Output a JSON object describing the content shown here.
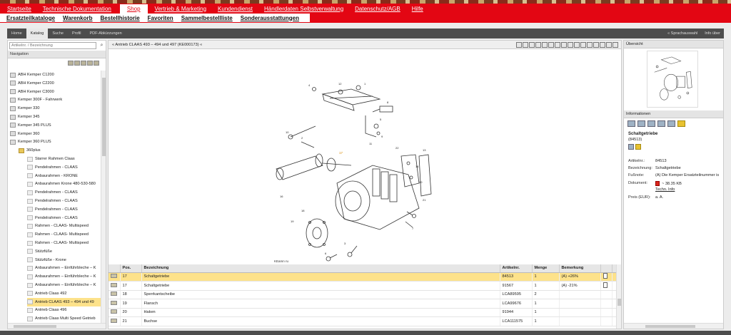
{
  "main_nav": {
    "items": [
      "Startseite",
      "Technische Dokumentation",
      "Shop",
      "Vertrieb & Marketing",
      "Kundendienst",
      "Händlerdaten Selbstverwaltung",
      "Datenschutz/AGB",
      "Hilfe"
    ],
    "active": "Shop"
  },
  "sub_nav": {
    "items": [
      "Ersatzteilkataloge",
      "Warenkorb",
      "Bestellhistorie",
      "Favoriten",
      "Sammelbestellliste",
      "Sonderausstattungen"
    ]
  },
  "toolbar": {
    "tabs": [
      "Home",
      "Katalog",
      "Suche",
      "Profil",
      "PDF-Abkürzungen"
    ],
    "active_tab": "Katalog",
    "language_link": "« Sprachauswahl",
    "about_link": "Info über"
  },
  "navigation": {
    "search_placeholder": "Artikelnr. / Bezeichnung",
    "header": "Navigation",
    "tree": [
      {
        "label": "ABH Kemper C1200",
        "level": 0,
        "kind": "item"
      },
      {
        "label": "ABH Kemper C2200",
        "level": 0,
        "kind": "item"
      },
      {
        "label": "ABH Kemper C3000",
        "level": 0,
        "kind": "item"
      },
      {
        "label": "Kemper 300F - Fahrwerk",
        "level": 0,
        "kind": "item"
      },
      {
        "label": "Kemper 330",
        "level": 0,
        "kind": "item"
      },
      {
        "label": "Kemper 345",
        "level": 0,
        "kind": "item"
      },
      {
        "label": "Kemper 345 PLUS",
        "level": 0,
        "kind": "item"
      },
      {
        "label": "Kemper 360",
        "level": 0,
        "kind": "item"
      },
      {
        "label": "Kemper 360 PLUS",
        "level": 0,
        "kind": "item"
      },
      {
        "label": "360plus",
        "level": 1,
        "kind": "folder"
      },
      {
        "label": "Starrer Rahmen Claas",
        "level": 2,
        "kind": "doc"
      },
      {
        "label": "Pendelrahmen - CLAAS",
        "level": 2,
        "kind": "doc"
      },
      {
        "label": "Anbaurahmen - KRONE",
        "level": 2,
        "kind": "doc"
      },
      {
        "label": "Anbaurahmen Krone 480-530-580",
        "level": 2,
        "kind": "doc"
      },
      {
        "label": "Pendelrahmen - CLAAS",
        "level": 2,
        "kind": "doc"
      },
      {
        "label": "Pendelrahmen - CLAAS",
        "level": 2,
        "kind": "doc"
      },
      {
        "label": "Pendelrahmen - CLAAS",
        "level": 2,
        "kind": "doc"
      },
      {
        "label": "Pendelrahmen - CLAAS",
        "level": 2,
        "kind": "doc"
      },
      {
        "label": "Rahmen - CLAAS- Multispeed",
        "level": 2,
        "kind": "doc"
      },
      {
        "label": "Rahmen - CLAAS- Multispeed",
        "level": 2,
        "kind": "doc"
      },
      {
        "label": "Rahmen - CLAAS- Multispeed",
        "level": 2,
        "kind": "doc"
      },
      {
        "label": "Stützfüße",
        "level": 2,
        "kind": "doc"
      },
      {
        "label": "Stützfüße - Krone",
        "level": 2,
        "kind": "doc"
      },
      {
        "label": "Anbaurahmen – Einführbleche – K",
        "level": 2,
        "kind": "doc"
      },
      {
        "label": "Anbaurahmen – Einführbleche – K",
        "level": 2,
        "kind": "doc"
      },
      {
        "label": "Anbaurahmen – Einführbleche – K",
        "level": 2,
        "kind": "doc"
      },
      {
        "label": "Antrieb Claas 492",
        "level": 2,
        "kind": "doc"
      },
      {
        "label": "Antrieb CLAAS 493 – 494 und 49",
        "level": 2,
        "kind": "doc",
        "selected": true
      },
      {
        "label": "Antrieb Claas 496",
        "level": 2,
        "kind": "doc"
      },
      {
        "label": "Antrieb Claas Multi Speed Getrieb",
        "level": 2,
        "kind": "doc"
      }
    ]
  },
  "center": {
    "breadcrumb": "« Antrieb CLAAS 493 – 494 und 497 (KE000173) «",
    "drawing_caption": "KEamn ru",
    "view_icons": [
      "home-icon",
      "zoom-in-icon",
      "zoom-out-icon",
      "zoom-fit-icon",
      "zoom-width-icon",
      "zoom-area-icon",
      "pan-icon",
      "layout-1-icon",
      "layout-2-icon",
      "layout-3-icon",
      "layout-4-icon",
      "fullscreen-icon",
      "previous-icon",
      "next-icon",
      "pdf-icon",
      "print-icon"
    ]
  },
  "parts_table": {
    "columns": [
      "Pos.",
      "Bezeichnung",
      "Artikelnr.",
      "Menge",
      "Bemerkung"
    ],
    "rows": [
      {
        "pos": "17",
        "name": "Schaltgetriebe",
        "article": "84513",
        "qty": "1",
        "note": "(A) +26%",
        "selected": true,
        "doc": true
      },
      {
        "pos": "17",
        "name": "Schaltgetriebe",
        "article": "91567",
        "qty": "1",
        "note": "(A) -21%",
        "selected": false,
        "doc": true
      },
      {
        "pos": "18",
        "name": "Sperrkantscheibe",
        "article": "LCA89595",
        "qty": "2",
        "note": "",
        "selected": false,
        "doc": false
      },
      {
        "pos": "19",
        "name": "Flansch",
        "article": "LCA99676",
        "qty": "1",
        "note": "",
        "selected": false,
        "doc": false
      },
      {
        "pos": "20",
        "name": "Haken",
        "article": "91944",
        "qty": "1",
        "note": "",
        "selected": false,
        "doc": false
      },
      {
        "pos": "21",
        "name": "Buchse",
        "article": "LCA111575",
        "qty": "1",
        "note": "",
        "selected": false,
        "doc": false
      }
    ]
  },
  "overview": {
    "header": "Übersicht"
  },
  "info": {
    "header": "Informationen",
    "title": "Schaltgetriebe",
    "subtitle": "(84513)",
    "fields": [
      {
        "key": "Artikelnr.:",
        "value": "84513"
      },
      {
        "key": "Bezeichnung:",
        "value": "Schaltgetriebe"
      },
      {
        "key": "Fußnote:",
        "value": "(A) Die Kemper Ersatzteilnummer is"
      }
    ],
    "document_label": "Dokument:",
    "document_size": "~ 38.35 KB",
    "document_link": "Techn. Info",
    "price_label": "Preis (EUR):",
    "price_value": "a. A."
  }
}
